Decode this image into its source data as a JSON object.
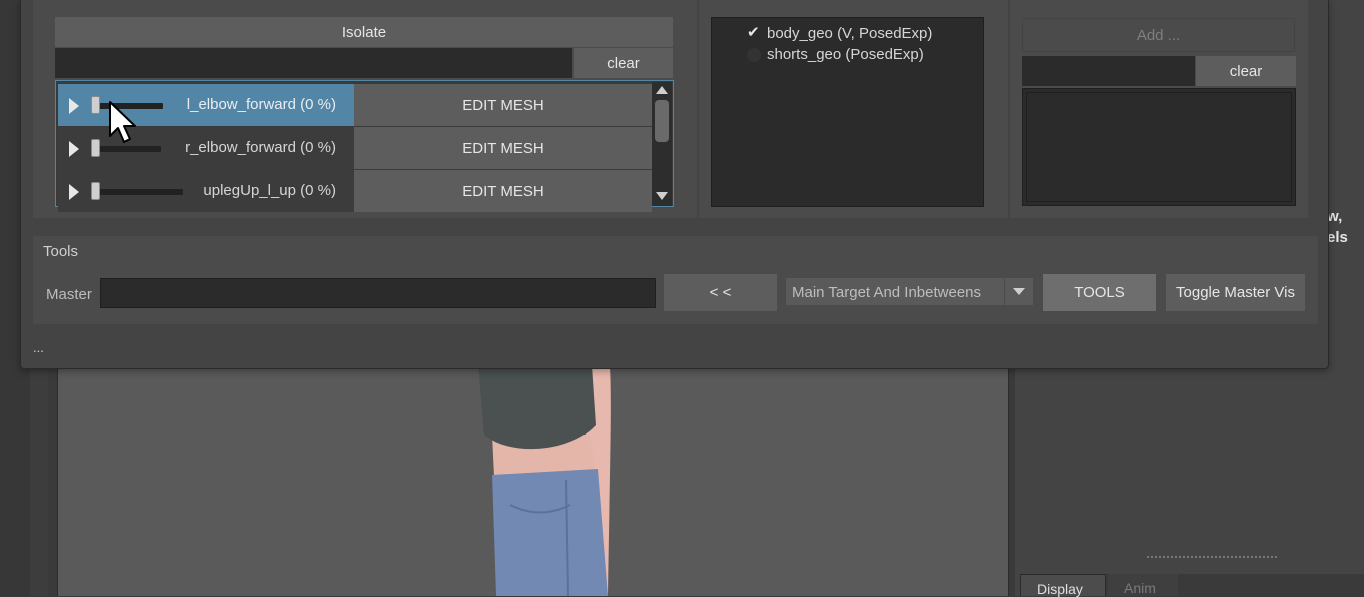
{
  "shapes_panel": {
    "isolate_label": "Isolate",
    "clear_label": "clear",
    "rows": [
      {
        "label": "l_elbow_forward (0 %)",
        "edit_label": "EDIT MESH",
        "selected": true
      },
      {
        "label": "r_elbow_forward (0 %)",
        "edit_label": "EDIT MESH",
        "selected": false
      },
      {
        "label": "uplegUp_l_up (0 %)",
        "edit_label": "EDIT MESH",
        "selected": false
      }
    ]
  },
  "geo_panel": {
    "items": [
      {
        "label": "body_geo (V, PosedExp)",
        "checked": true
      },
      {
        "label": "shorts_geo (PosedExp)",
        "checked": false
      }
    ]
  },
  "right_panel": {
    "add_label": "Add ...",
    "clear_label": "clear"
  },
  "tools": {
    "group_label": "Tools",
    "master_label": "Master",
    "back_label": "< <",
    "mode_selected": "Main Target And Inbetweens",
    "tools_label": "TOOLS",
    "toggle_label": "Toggle Master Vis"
  },
  "status_text": "...",
  "background": {
    "partial_text_1": "w,",
    "partial_text_2": "els",
    "tabs": [
      "Display",
      "Anim"
    ]
  },
  "colors": {
    "selection": "#5285a6",
    "panel": "#444444",
    "button": "#5d5d5d"
  }
}
